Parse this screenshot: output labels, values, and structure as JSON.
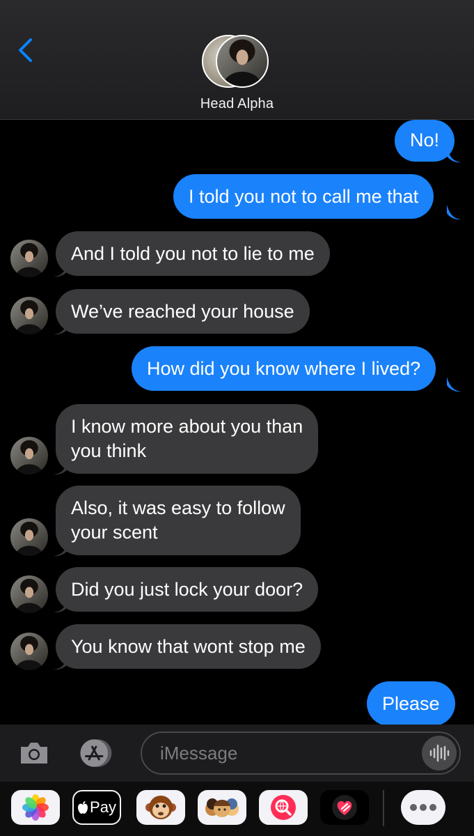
{
  "header": {
    "contact_name": "Head Alpha",
    "back_icon": "chevron-left-icon"
  },
  "messages": [
    {
      "direction": "outgoing",
      "text": "No!"
    },
    {
      "direction": "outgoing",
      "text": "I told you not to call me that"
    },
    {
      "direction": "incoming",
      "text": "And I told you not to lie to me"
    },
    {
      "direction": "incoming",
      "text": "We’ve reached your house"
    },
    {
      "direction": "outgoing",
      "text": "How did you know where I lived?"
    },
    {
      "direction": "incoming",
      "line1": "I know more about you than",
      "line2": "you think"
    },
    {
      "direction": "incoming",
      "line1": "Also, it was easy to follow",
      "line2": "your scent"
    },
    {
      "direction": "incoming",
      "text": "Did you just lock your door?"
    },
    {
      "direction": "incoming",
      "text": "You know that wont stop me"
    },
    {
      "direction": "outgoing",
      "text": "Please"
    }
  ],
  "input": {
    "placeholder": "iMessage"
  },
  "app_drawer": {
    "apple_pay_label": "Pay",
    "apps": [
      "photos-icon",
      "apple-pay-icon",
      "animoji-icon",
      "memoji-icon",
      "web-search-icon",
      "digital-touch-icon",
      "more-apps-icon"
    ]
  },
  "colors": {
    "outgoing_bubble": "#1a82fb",
    "incoming_bubble": "#3a3a3c",
    "accent": "#0a84ff"
  }
}
